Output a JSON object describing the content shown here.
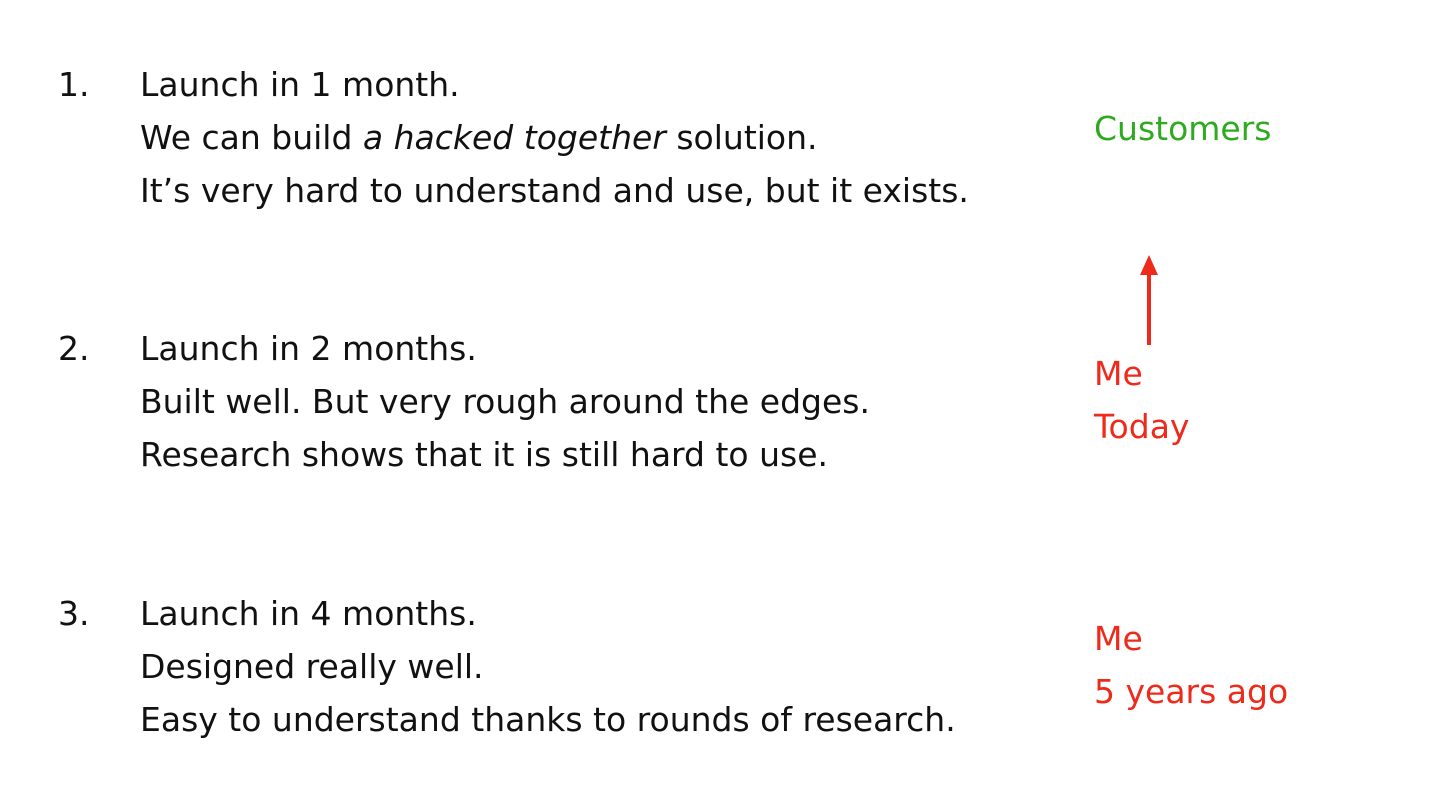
{
  "options": [
    {
      "number": "1.",
      "line1": "Launch in 1 month.",
      "line2_before": "We can build ",
      "line2_em": "a hacked together",
      "line2_after": " solution.",
      "line3": "It’s very hard to understand and use, but it exists."
    },
    {
      "number": "2.",
      "line1": "Launch in 2 months.",
      "line2": "Built well. But very rough around the edges.",
      "line3": "Research shows that it is still hard to use."
    },
    {
      "number": "3.",
      "line1": "Launch in 4 months.",
      "line2": "Designed really well.",
      "line3": "Easy to understand thanks to rounds of research."
    }
  ],
  "labels": {
    "customers": "Customers",
    "me_today_line1": "Me",
    "me_today_line2": "Today",
    "me_past_line1": "Me",
    "me_past_line2": "5 years ago"
  },
  "colors": {
    "customers": "#2eaa1f",
    "me": "#ee2a1b",
    "text": "#111111"
  },
  "icons": {
    "arrow": "arrow-up-icon"
  }
}
